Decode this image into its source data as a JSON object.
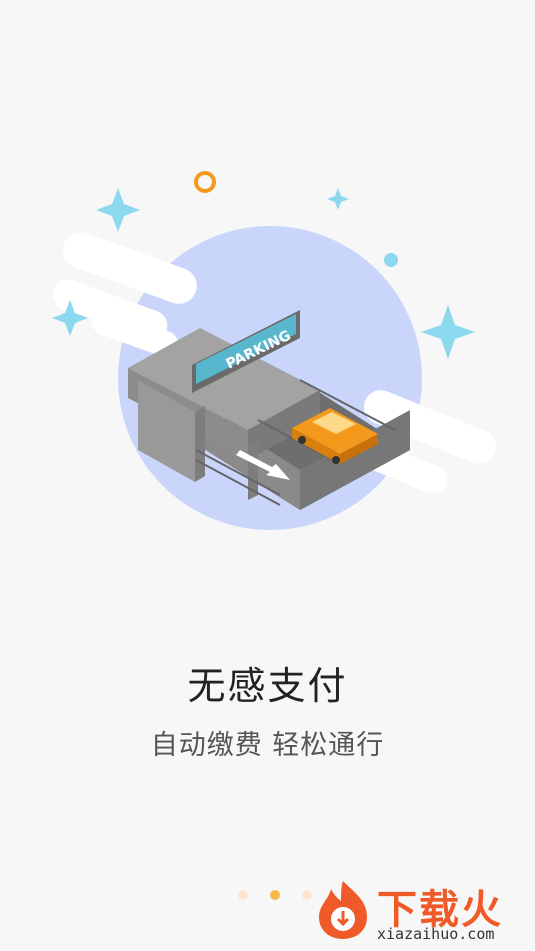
{
  "title": "无感支付",
  "subtitle": "自动缴费  轻松通行",
  "parking_sign": "PARKING",
  "pager": {
    "count": 3,
    "active_index": 1
  },
  "watermark": {
    "title": "下载火",
    "url": "xiazaihuo.com"
  },
  "colors": {
    "background": "#f7f7f7",
    "circle": "#c9d5fb",
    "sparkle": "#8cd8ee",
    "car": "#f39a1d",
    "dot_active": "#f8b84a",
    "dot_inactive": "#fde6cc"
  }
}
